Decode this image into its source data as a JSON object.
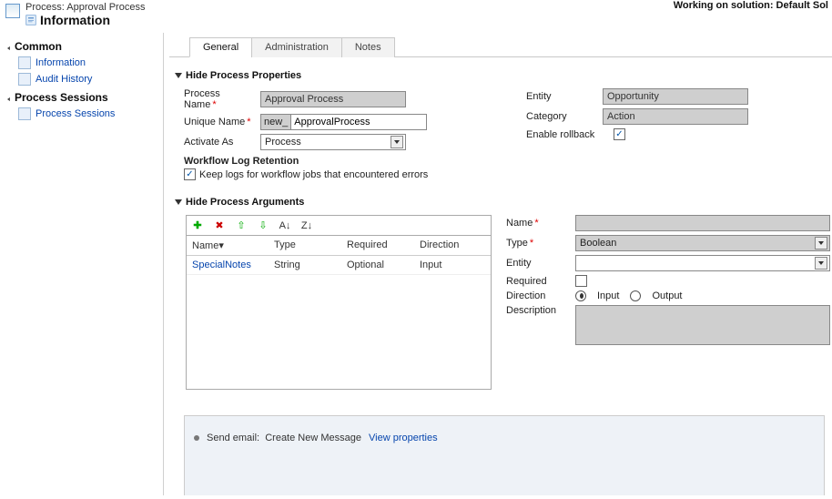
{
  "header": {
    "processLabel": "Process: Approval Process",
    "title": "Information",
    "workingOn": "Working on solution: Default Sol"
  },
  "sidebar": {
    "sections": [
      {
        "title": "Common",
        "items": [
          {
            "label": "Information"
          },
          {
            "label": "Audit History"
          }
        ]
      },
      {
        "title": "Process Sessions",
        "items": [
          {
            "label": "Process Sessions"
          }
        ]
      }
    ]
  },
  "tabs": [
    {
      "label": "General",
      "active": true
    },
    {
      "label": "Administration",
      "active": false
    },
    {
      "label": "Notes",
      "active": false
    }
  ],
  "props": {
    "sectionTitle": "Hide Process Properties",
    "processNameLabel": "Process Name",
    "processNameValue": "Approval Process",
    "uniqueNameLabel": "Unique Name",
    "uniquePrefix": "new_",
    "uniqueValue": "ApprovalProcess",
    "activateAsLabel": "Activate As",
    "activateAsValue": "Process",
    "workflowLogHdr": "Workflow Log Retention",
    "keepLogsLabel": "Keep logs for workflow jobs that encountered errors",
    "entityLabel": "Entity",
    "entityValue": "Opportunity",
    "categoryLabel": "Category",
    "categoryValue": "Action",
    "enableRollbackLabel": "Enable rollback"
  },
  "args": {
    "sectionTitle": "Hide Process Arguments",
    "gridHeaders": {
      "name": "Name▾",
      "type": "Type",
      "required": "Required",
      "direction": "Direction"
    },
    "rows": [
      {
        "name": "SpecialNotes",
        "type": "String",
        "required": "Optional",
        "direction": "Input"
      }
    ],
    "form": {
      "nameLabel": "Name",
      "nameValue": "",
      "typeLabel": "Type",
      "typeValue": "Boolean",
      "entityLabel": "Entity",
      "entityValue": "",
      "requiredLabel": "Required",
      "directionLabel": "Direction",
      "inputLabel": "Input",
      "outputLabel": "Output",
      "descriptionLabel": "Description"
    }
  },
  "bottom": {
    "stepPrefix": "Send email:",
    "stepText": "Create New Message",
    "viewProps": "View properties"
  }
}
